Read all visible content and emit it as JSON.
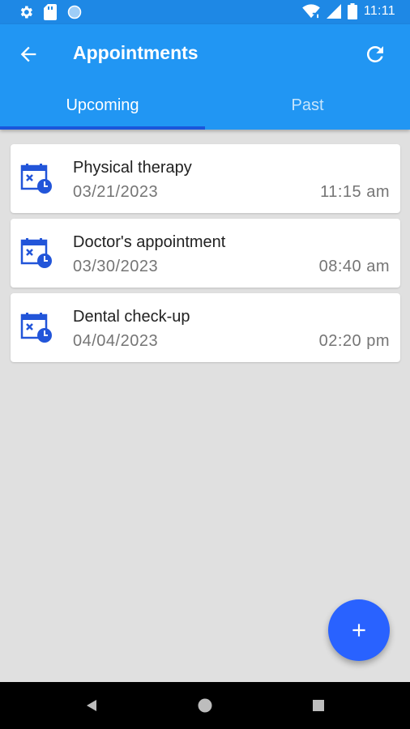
{
  "status_bar": {
    "time": "11:11",
    "icons": [
      "settings-icon",
      "sim-card-icon",
      "circle-icon",
      "wifi-icon",
      "signal-icon",
      "battery-icon"
    ]
  },
  "app_bar": {
    "title": "Appointments",
    "back_icon": "arrow-back-icon",
    "refresh_icon": "refresh-icon"
  },
  "tabs": [
    {
      "label": "Upcoming",
      "active": true
    },
    {
      "label": "Past",
      "active": false
    }
  ],
  "appointments": [
    {
      "title": "Physical therapy",
      "date": "03/21/2023",
      "time": "11:15 am",
      "icon": "calendar-clock-icon"
    },
    {
      "title": "Doctor's appointment",
      "date": "03/30/2023",
      "time": "08:40 am",
      "icon": "calendar-clock-icon"
    },
    {
      "title": "Dental check-up",
      "date": "04/04/2023",
      "time": "02:20 pm",
      "icon": "calendar-clock-icon"
    }
  ],
  "fab": {
    "icon": "plus-icon"
  },
  "nav_bar": {
    "icons": [
      "back-triangle-icon",
      "home-circle-icon",
      "recents-square-icon"
    ]
  },
  "colors": {
    "status_bar": "#1e88e5",
    "app_bar": "#2196f3",
    "tab_indicator": "#1a56db",
    "fab": "#2962ff",
    "background": "#e0e0e0"
  }
}
